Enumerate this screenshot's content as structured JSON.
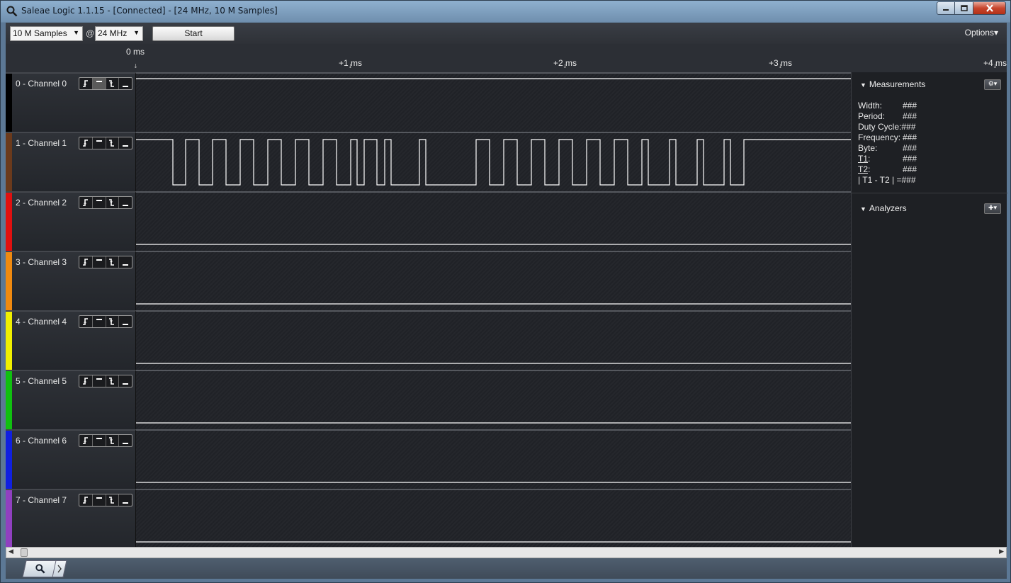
{
  "window": {
    "title": "Saleae Logic 1.1.15 - [Connected] - [24 MHz, 10 M Samples]"
  },
  "toolbar": {
    "samples_value": "10 M Samples",
    "at_symbol": "@",
    "rate_value": "24 MHz",
    "start_label": "Start",
    "options_label": "Options▾"
  },
  "ruler": {
    "origin_label": "0 ms",
    "ticks": [
      "+1 ms",
      "+2 ms",
      "+3 ms",
      "+4 ms"
    ]
  },
  "channels": [
    {
      "name": "0 - Channel 0",
      "color": "#000000"
    },
    {
      "name": "1 - Channel 1",
      "color": "#6b3a1c"
    },
    {
      "name": "2 - Channel 2",
      "color": "#e01010"
    },
    {
      "name": "3 - Channel 3",
      "color": "#f08a10"
    },
    {
      "name": "4 - Channel 4",
      "color": "#f0f000"
    },
    {
      "name": "5 - Channel 5",
      "color": "#10c010"
    },
    {
      "name": "6 - Channel 6",
      "color": "#1020e0"
    },
    {
      "name": "7 - Channel 7",
      "color": "#9040c0"
    }
  ],
  "measurements": {
    "header": "Measurements",
    "rows": [
      {
        "label": "Width:",
        "value": "###"
      },
      {
        "label": "Period:",
        "value": "###"
      },
      {
        "label": "Duty Cycle:",
        "value": "###"
      },
      {
        "label": "Frequency:",
        "value": "###"
      },
      {
        "label": "Byte:",
        "value": "###"
      },
      {
        "label": "T1",
        "suffix": ":",
        "value": "###"
      },
      {
        "label": "T2",
        "suffix": ":",
        "value": "###"
      },
      {
        "label": "| T1 - T2 | =",
        "value": "###"
      }
    ]
  },
  "analyzers": {
    "header": "Analyzers"
  },
  "icons": {
    "app": "magnifier-icon",
    "measure_settings": "gear-icon",
    "add_analyzer": "plus-icon",
    "bottom_tab_1": "search-icon",
    "bottom_tab_2": "chevron-right-icon"
  }
}
